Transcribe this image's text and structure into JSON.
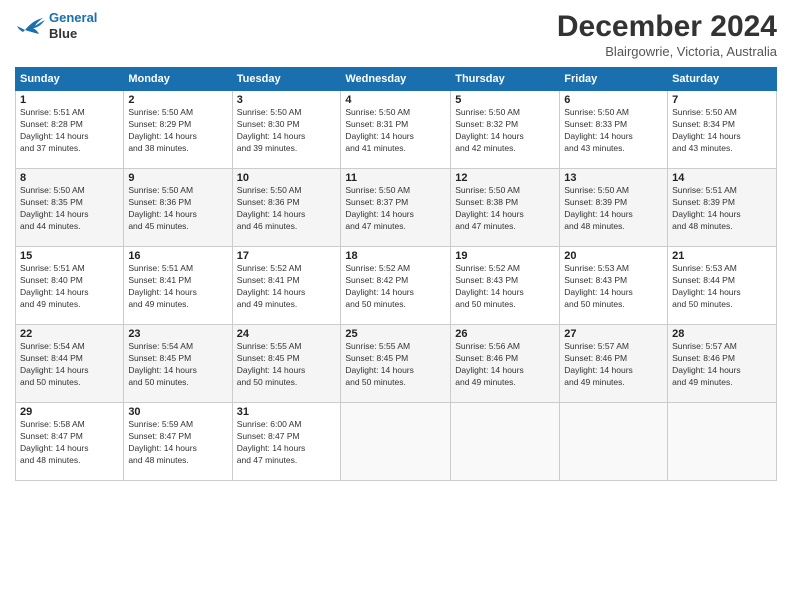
{
  "header": {
    "logo_line1": "General",
    "logo_line2": "Blue",
    "month_title": "December 2024",
    "location": "Blairgowrie, Victoria, Australia"
  },
  "weekdays": [
    "Sunday",
    "Monday",
    "Tuesday",
    "Wednesday",
    "Thursday",
    "Friday",
    "Saturday"
  ],
  "weeks": [
    [
      {
        "day": "1",
        "info": "Sunrise: 5:51 AM\nSunset: 8:28 PM\nDaylight: 14 hours\nand 37 minutes."
      },
      {
        "day": "2",
        "info": "Sunrise: 5:50 AM\nSunset: 8:29 PM\nDaylight: 14 hours\nand 38 minutes."
      },
      {
        "day": "3",
        "info": "Sunrise: 5:50 AM\nSunset: 8:30 PM\nDaylight: 14 hours\nand 39 minutes."
      },
      {
        "day": "4",
        "info": "Sunrise: 5:50 AM\nSunset: 8:31 PM\nDaylight: 14 hours\nand 41 minutes."
      },
      {
        "day": "5",
        "info": "Sunrise: 5:50 AM\nSunset: 8:32 PM\nDaylight: 14 hours\nand 42 minutes."
      },
      {
        "day": "6",
        "info": "Sunrise: 5:50 AM\nSunset: 8:33 PM\nDaylight: 14 hours\nand 43 minutes."
      },
      {
        "day": "7",
        "info": "Sunrise: 5:50 AM\nSunset: 8:34 PM\nDaylight: 14 hours\nand 43 minutes."
      }
    ],
    [
      {
        "day": "8",
        "info": "Sunrise: 5:50 AM\nSunset: 8:35 PM\nDaylight: 14 hours\nand 44 minutes."
      },
      {
        "day": "9",
        "info": "Sunrise: 5:50 AM\nSunset: 8:36 PM\nDaylight: 14 hours\nand 45 minutes."
      },
      {
        "day": "10",
        "info": "Sunrise: 5:50 AM\nSunset: 8:36 PM\nDaylight: 14 hours\nand 46 minutes."
      },
      {
        "day": "11",
        "info": "Sunrise: 5:50 AM\nSunset: 8:37 PM\nDaylight: 14 hours\nand 47 minutes."
      },
      {
        "day": "12",
        "info": "Sunrise: 5:50 AM\nSunset: 8:38 PM\nDaylight: 14 hours\nand 47 minutes."
      },
      {
        "day": "13",
        "info": "Sunrise: 5:50 AM\nSunset: 8:39 PM\nDaylight: 14 hours\nand 48 minutes."
      },
      {
        "day": "14",
        "info": "Sunrise: 5:51 AM\nSunset: 8:39 PM\nDaylight: 14 hours\nand 48 minutes."
      }
    ],
    [
      {
        "day": "15",
        "info": "Sunrise: 5:51 AM\nSunset: 8:40 PM\nDaylight: 14 hours\nand 49 minutes."
      },
      {
        "day": "16",
        "info": "Sunrise: 5:51 AM\nSunset: 8:41 PM\nDaylight: 14 hours\nand 49 minutes."
      },
      {
        "day": "17",
        "info": "Sunrise: 5:52 AM\nSunset: 8:41 PM\nDaylight: 14 hours\nand 49 minutes."
      },
      {
        "day": "18",
        "info": "Sunrise: 5:52 AM\nSunset: 8:42 PM\nDaylight: 14 hours\nand 50 minutes."
      },
      {
        "day": "19",
        "info": "Sunrise: 5:52 AM\nSunset: 8:43 PM\nDaylight: 14 hours\nand 50 minutes."
      },
      {
        "day": "20",
        "info": "Sunrise: 5:53 AM\nSunset: 8:43 PM\nDaylight: 14 hours\nand 50 minutes."
      },
      {
        "day": "21",
        "info": "Sunrise: 5:53 AM\nSunset: 8:44 PM\nDaylight: 14 hours\nand 50 minutes."
      }
    ],
    [
      {
        "day": "22",
        "info": "Sunrise: 5:54 AM\nSunset: 8:44 PM\nDaylight: 14 hours\nand 50 minutes."
      },
      {
        "day": "23",
        "info": "Sunrise: 5:54 AM\nSunset: 8:45 PM\nDaylight: 14 hours\nand 50 minutes."
      },
      {
        "day": "24",
        "info": "Sunrise: 5:55 AM\nSunset: 8:45 PM\nDaylight: 14 hours\nand 50 minutes."
      },
      {
        "day": "25",
        "info": "Sunrise: 5:55 AM\nSunset: 8:45 PM\nDaylight: 14 hours\nand 50 minutes."
      },
      {
        "day": "26",
        "info": "Sunrise: 5:56 AM\nSunset: 8:46 PM\nDaylight: 14 hours\nand 49 minutes."
      },
      {
        "day": "27",
        "info": "Sunrise: 5:57 AM\nSunset: 8:46 PM\nDaylight: 14 hours\nand 49 minutes."
      },
      {
        "day": "28",
        "info": "Sunrise: 5:57 AM\nSunset: 8:46 PM\nDaylight: 14 hours\nand 49 minutes."
      }
    ],
    [
      {
        "day": "29",
        "info": "Sunrise: 5:58 AM\nSunset: 8:47 PM\nDaylight: 14 hours\nand 48 minutes."
      },
      {
        "day": "30",
        "info": "Sunrise: 5:59 AM\nSunset: 8:47 PM\nDaylight: 14 hours\nand 48 minutes."
      },
      {
        "day": "31",
        "info": "Sunrise: 6:00 AM\nSunset: 8:47 PM\nDaylight: 14 hours\nand 47 minutes."
      },
      {
        "day": "",
        "info": ""
      },
      {
        "day": "",
        "info": ""
      },
      {
        "day": "",
        "info": ""
      },
      {
        "day": "",
        "info": ""
      }
    ]
  ]
}
